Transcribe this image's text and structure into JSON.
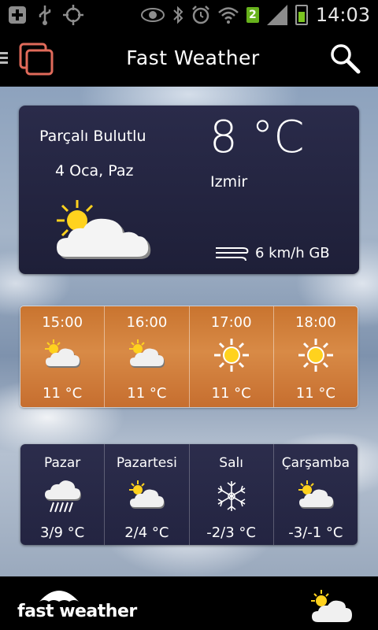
{
  "status_bar": {
    "time": "14:03",
    "notification_count": "2",
    "icons": [
      "plus-icon",
      "usb-icon",
      "gps-icon",
      "eye-icon",
      "bluetooth-icon",
      "alarm-icon",
      "wifi-icon",
      "signal-icon",
      "battery-icon"
    ]
  },
  "app": {
    "title": "Fast Weather",
    "icons": {
      "menu": "menu-icon",
      "app": "app-icon",
      "search": "search-icon"
    }
  },
  "current": {
    "condition": "Parçalı Bulutlu",
    "date": "4 Oca, Paz",
    "temperature": "8 °C",
    "city": "Izmir",
    "wind": "6 km/h GB",
    "icon": "partly-cloudy-icon"
  },
  "hourly": [
    {
      "time": "15:00",
      "temp": "11 °C",
      "icon": "partly-cloudy-icon"
    },
    {
      "time": "16:00",
      "temp": "11 °C",
      "icon": "partly-cloudy-icon"
    },
    {
      "time": "17:00",
      "temp": "11 °C",
      "icon": "sun-icon"
    },
    {
      "time": "18:00",
      "temp": "11 °C",
      "icon": "sun-icon"
    }
  ],
  "daily": [
    {
      "day": "Pazar",
      "temp": "3/9 °C",
      "icon": "rain-icon"
    },
    {
      "day": "Pazartesi",
      "temp": "2/4 °C",
      "icon": "partly-cloudy-icon"
    },
    {
      "day": "Salı",
      "temp": "-2/3 °C",
      "icon": "snow-icon"
    },
    {
      "day": "Çarşamba",
      "temp": "-3/-1 °C",
      "icon": "partly-cloudy-icon"
    }
  ],
  "footer": {
    "brand": "fast weather",
    "icon": "partly-cloudy-icon"
  },
  "colors": {
    "accent": "#e06a5a",
    "card_dark": "#23243f",
    "hourly_orange": "#d0803c",
    "sun": "#ffd21e"
  }
}
